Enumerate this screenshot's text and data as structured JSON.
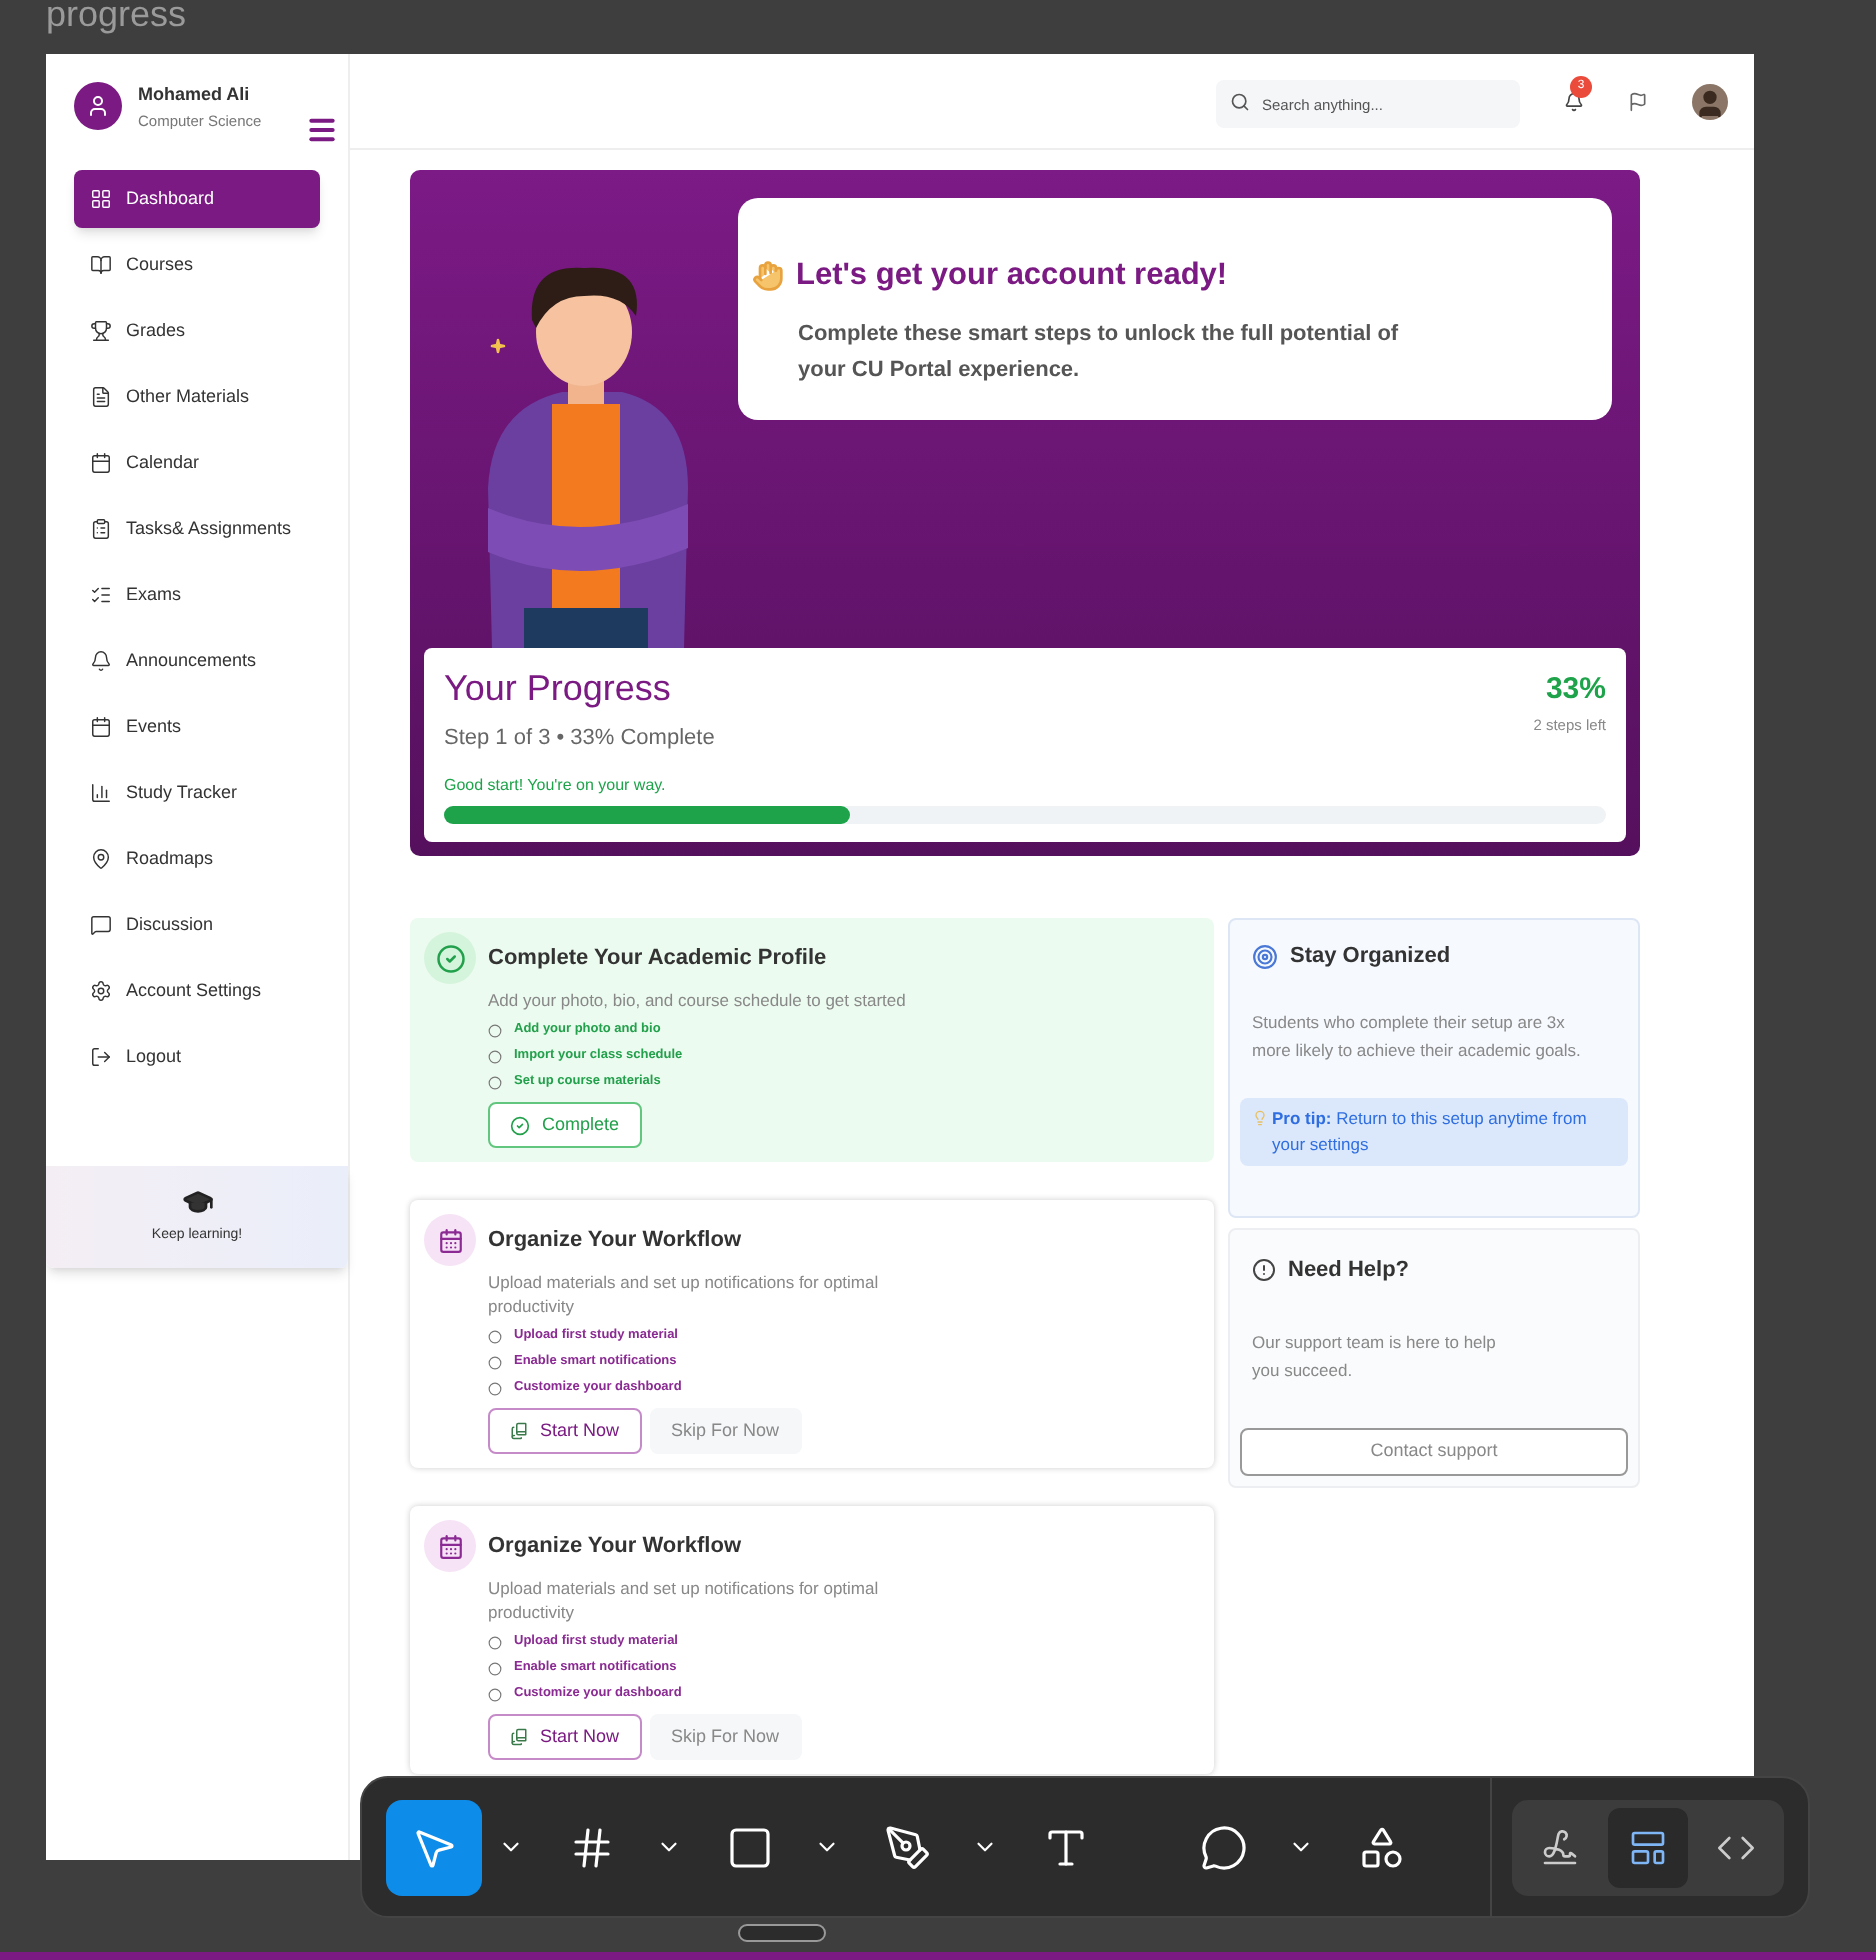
{
  "canvas_title": "progress",
  "sidebar": {
    "profile": {
      "name": "Mohamed Ali",
      "subtitle": "Computer Science"
    },
    "items": [
      {
        "label": "Dashboard",
        "selected": true
      },
      {
        "label": "Courses",
        "selected": false
      },
      {
        "label": "Grades",
        "selected": false
      },
      {
        "label": "Other Materials",
        "selected": false
      },
      {
        "label": "Calendar",
        "selected": false
      },
      {
        "label": "Tasks& Assignments",
        "selected": false
      },
      {
        "label": "Exams",
        "selected": false
      },
      {
        "label": "Announcements",
        "selected": false
      },
      {
        "label": "Events",
        "selected": false
      },
      {
        "label": "Study Tracker",
        "selected": false
      },
      {
        "label": "Roadmaps",
        "selected": false
      },
      {
        "label": "Discussion",
        "selected": false
      },
      {
        "label": "Account Settings",
        "selected": false
      },
      {
        "label": "Logout",
        "selected": false
      }
    ],
    "footer": {
      "text": "Keep learning!"
    }
  },
  "header": {
    "search": {
      "placeholder": "Search anything..."
    },
    "notifications": {
      "badge": "3"
    }
  },
  "hero": {
    "title": "Let's get your account ready!",
    "text": "Complete these smart steps to unlock the full potential of your CU Portal experience.",
    "progress": {
      "title": "Your Progress",
      "subtitle": "Step 1 of 3 • 33% Complete",
      "percent": "33%",
      "remaining": "2 steps left",
      "message": "Good start! You're on your way.",
      "level": 0.35
    }
  },
  "steps": [
    {
      "title": "Complete Your Academic Profile",
      "description": "Add your photo, bio, and course schedule to get started",
      "completed": true,
      "tasks": [
        {
          "label": "Add your photo and bio",
          "checked": false
        },
        {
          "label": "Import your class schedule",
          "checked": false
        },
        {
          "label": "Set up course materials",
          "checked": false
        }
      ],
      "buttons": [
        {
          "label": "Complete",
          "kind": "complete"
        }
      ]
    },
    {
      "title": "Organize Your Workflow",
      "description": "Upload materials and set up notifications for optimal productivity",
      "completed": false,
      "tasks": [
        {
          "label": "Upload first study material",
          "checked": false
        },
        {
          "label": "Enable smart notifications",
          "checked": false
        },
        {
          "label": "Customize your dashboard",
          "checked": false
        }
      ],
      "buttons": [
        {
          "label": "Start Now",
          "kind": "primary"
        },
        {
          "label": "Skip For Now",
          "kind": "secondary"
        }
      ]
    },
    {
      "title": "Organize Your Workflow",
      "description": "Upload materials and set up notifications for optimal productivity",
      "completed": false,
      "tasks": [
        {
          "label": "Upload first study material",
          "checked": false
        },
        {
          "label": "Enable smart notifications",
          "checked": false
        },
        {
          "label": "Customize your dashboard",
          "checked": false
        }
      ],
      "buttons": [
        {
          "label": "Start Now",
          "kind": "primary"
        },
        {
          "label": "Skip For Now",
          "kind": "secondary"
        }
      ]
    }
  ],
  "side_cards": [
    {
      "kind": "tip",
      "title": "Stay Organized",
      "text": "Students who complete their setup are 3x more likely to achieve their academic goals.",
      "tip": "**Pro tip:** Return to this setup anytime from your settings"
    },
    {
      "kind": "help",
      "title": "Need Help?",
      "text": "Our support team is here to help you succeed.",
      "button": "Contact support"
    }
  ],
  "toolbar": {
    "tools": [
      {
        "has_menu": true,
        "selected": true
      },
      {
        "has_menu": true,
        "selected": false
      },
      {
        "has_menu": true,
        "selected": false
      },
      {
        "has_menu": true,
        "selected": false
      },
      {
        "has_menu": false,
        "selected": false
      },
      {
        "has_menu": true,
        "selected": false
      },
      {
        "has_menu": false,
        "selected": false
      }
    ],
    "modes": [
      {
        "selected": false
      },
      {
        "selected": true
      },
      {
        "selected": false
      }
    ]
  }
}
